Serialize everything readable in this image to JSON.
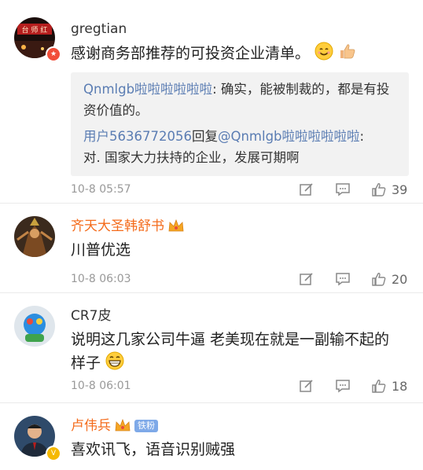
{
  "comments": [
    {
      "username": "gregtian",
      "text": "感谢商务部推荐的可投资企业清单。",
      "replies": [
        {
          "user": "Qnmlgb啦啦啦啦啦啦",
          "sep": ": ",
          "body": "确实，能被制裁的，都是有投资价值的。"
        },
        {
          "user": "用户5636772056",
          "mid": "回复",
          "target": "@Qnmlgb啦啦啦啦啦啦",
          "sep": ":",
          "body": "对. 国家大力扶持的企业，发展可期啊"
        }
      ],
      "time": "10-8 05:57",
      "likes": "39"
    },
    {
      "username": "齐天大圣韩舒书",
      "text": "川普优选",
      "time": "10-8 06:03",
      "likes": "20"
    },
    {
      "username": "CR7皮",
      "text": "说明这几家公司牛逼   老美现在就是一副输不起的样子",
      "time": "10-8 06:01",
      "likes": "18"
    },
    {
      "username": "卢伟兵",
      "badge_text": "铁粉",
      "text": "喜欢讯飞，语音识别贼强"
    }
  ],
  "icons": {
    "repost": "share-edit-icon",
    "comment": "comment-icon",
    "like": "thumbs-up-icon"
  },
  "colors": {
    "username_link": "#5b7db3",
    "vip_name": "#f46b1b",
    "meta": "#999999"
  }
}
